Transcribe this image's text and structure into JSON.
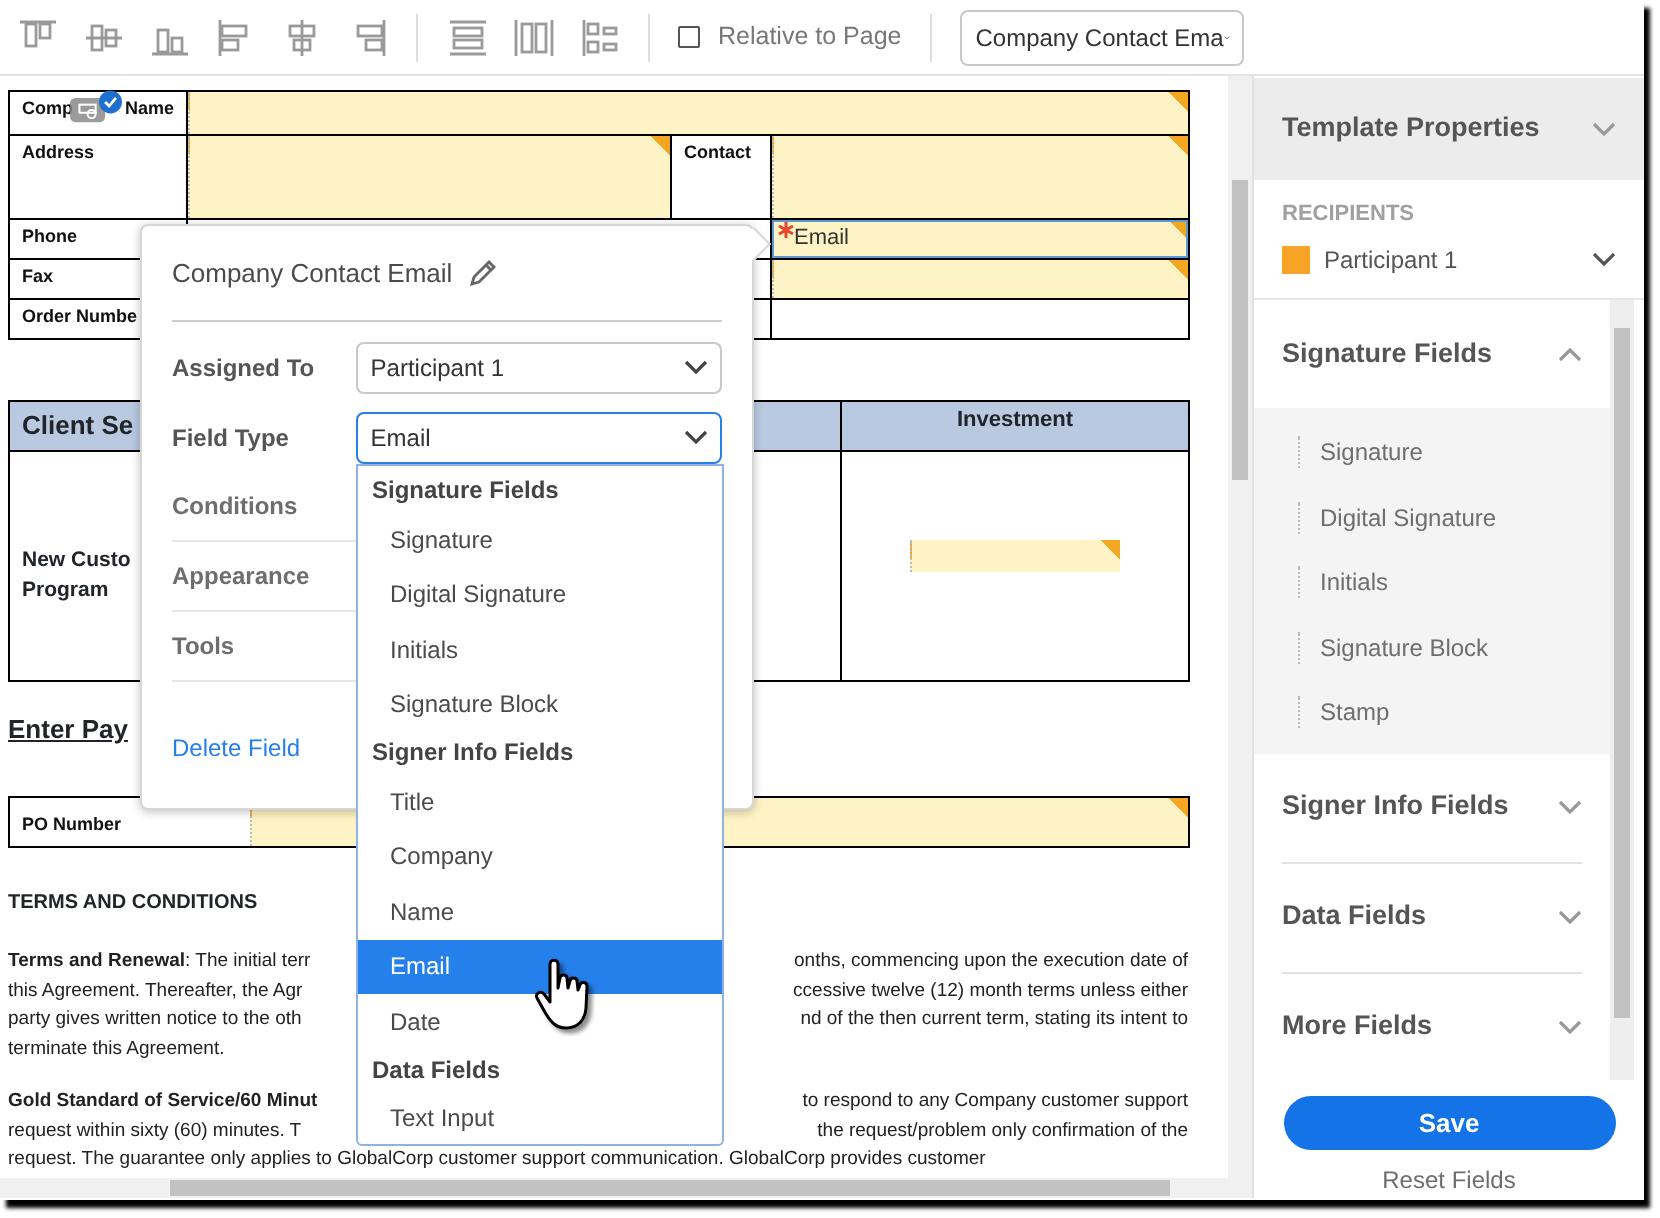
{
  "toolbar": {
    "relative_to_page": {
      "label": "Relative to Page",
      "checked": false
    },
    "field_select": {
      "value": "Company Contact Ema"
    }
  },
  "document": {
    "info_table": [
      {
        "cells": [
          {
            "kind": "label",
            "parts": [
              "Comp",
              "Name"
            ]
          },
          {
            "kind": "field",
            "colspan": 3,
            "required": false,
            "selected": false
          }
        ]
      },
      {
        "cells": [
          {
            "kind": "label",
            "parts": [
              "Address"
            ]
          },
          {
            "kind": "field",
            "required": false,
            "selected": false
          },
          {
            "kind": "label",
            "parts": [
              "Contact"
            ]
          },
          {
            "kind": "field",
            "required": false,
            "selected": false
          }
        ]
      },
      {
        "cells": [
          {
            "kind": "label",
            "parts": [
              "Phone"
            ]
          },
          {
            "kind": "empty",
            "colspan": 2
          },
          {
            "kind": "field",
            "label": "Email",
            "required": true,
            "selected": true
          }
        ]
      },
      {
        "cells": [
          {
            "kind": "label",
            "parts": [
              "Fax"
            ]
          },
          {
            "kind": "empty",
            "colspan": 2
          },
          {
            "kind": "field",
            "required": false,
            "selected": false
          }
        ]
      },
      {
        "cells": [
          {
            "kind": "label",
            "parts": [
              "Order Numbe"
            ]
          },
          {
            "kind": "empty",
            "colspan": 2
          },
          {
            "kind": "empty"
          }
        ]
      }
    ],
    "client_table": {
      "header": [
        {
          "kind": "section_title",
          "text": "Client Se"
        },
        {
          "kind": "column_heading",
          "text": "Investment"
        }
      ],
      "rows": [
        {
          "cells": [
            {
              "kind": "label",
              "lines": [
                "New Custo",
                "Program"
              ]
            },
            {
              "kind": "field",
              "required": false,
              "selected": false
            }
          ]
        }
      ]
    },
    "payment": {
      "heading": "Enter Pay",
      "rows": [
        {
          "label": "PO Number",
          "field": {
            "required": false,
            "selected": false
          }
        }
      ]
    },
    "terms": {
      "heading": "TERMS AND CONDITIONS",
      "paragraphs": [
        {
          "lines": [
            {
              "left": "**Terms and Renewal**: The initial terr",
              "right": "onths, commencing upon the execution date of"
            },
            {
              "left": "this Agreement. Thereafter, the Agr",
              "right": "ccessive twelve (12) month terms unless either"
            },
            {
              "left": "party gives written notice to the oth",
              "right": "nd of the then current term, stating its intent to"
            },
            {
              "left": "terminate this Agreement."
            }
          ]
        },
        {
          "lines": [
            {
              "left": "**Gold Standard of Service/60 Minut**",
              "right": "to respond to any Company customer support"
            },
            {
              "left": "request within sixty (60) minutes. T",
              "right": "the request/problem only confirmation of the"
            },
            {
              "left": "request. The guarantee only applies to GlobalCorp customer support communication. GlobalCorp provides customer"
            }
          ]
        }
      ]
    }
  },
  "field_popover": {
    "title": "Company Contact Email",
    "assigned_to": {
      "label": "Assigned To",
      "value": "Participant 1"
    },
    "field_type": {
      "label": "Field Type",
      "value": "Email",
      "expanded": true
    },
    "sections": [
      "Conditions",
      "Appearance",
      "Tools"
    ],
    "delete_link": "Delete Field"
  },
  "field_type_menu": {
    "groups": [
      {
        "header": "Signature Fields",
        "items": [
          {
            "label": "Signature",
            "selected": false
          },
          {
            "label": "Digital Signature",
            "selected": false
          },
          {
            "label": "Initials",
            "selected": false
          },
          {
            "label": "Signature Block",
            "selected": false
          }
        ]
      },
      {
        "header": "Signer Info Fields",
        "items": [
          {
            "label": "Title",
            "selected": false
          },
          {
            "label": "Company",
            "selected": false
          },
          {
            "label": "Name",
            "selected": false
          },
          {
            "label": "Email",
            "selected": true
          },
          {
            "label": "Date",
            "selected": false
          }
        ]
      },
      {
        "header": "Data Fields",
        "items": [
          {
            "label": "Text Input",
            "selected": false
          }
        ]
      }
    ]
  },
  "right_panel": {
    "title": "Template Properties",
    "recipients": {
      "heading": "RECIPIENTS",
      "participants": [
        {
          "name": "Participant 1",
          "color": "#f7a325"
        }
      ]
    },
    "field_groups": [
      {
        "title": "Signature Fields",
        "expanded": true,
        "items": [
          "Signature",
          "Digital Signature",
          "Initials",
          "Signature Block",
          "Stamp"
        ]
      },
      {
        "title": "Signer Info Fields",
        "expanded": false
      },
      {
        "title": "Data Fields",
        "expanded": false
      },
      {
        "title": "More Fields",
        "expanded": false
      }
    ],
    "save_button": "Save",
    "reset_link": "Reset Fields"
  }
}
